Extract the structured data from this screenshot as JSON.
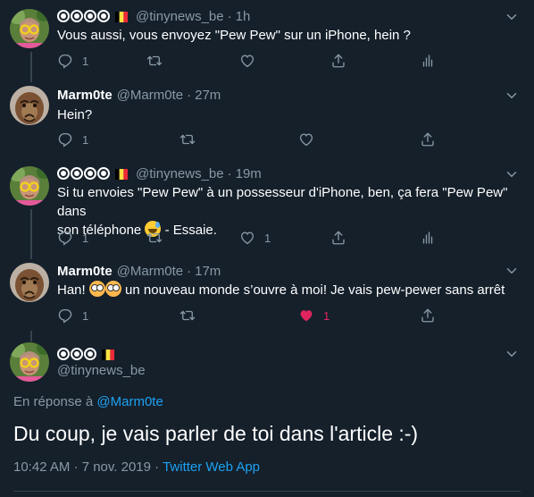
{
  "tweets": [
    {
      "name_circles": 3,
      "handle": "@tinynews_be",
      "time": "1h",
      "text": "Vous aussi, vous envoyez \"Pew Pew\" sur un iPhone, hein ?",
      "reply_count": "1",
      "like_count": ""
    },
    {
      "name": "Marm0te",
      "handle": "@Marm0te",
      "time": "27m",
      "text": "Hein?",
      "reply_count": "1"
    },
    {
      "handle": "@tinynews_be",
      "time": "19m",
      "text_part1": "Si tu envoies \"Pew Pew\" à un possesseur d'iPhone, ben, ça fera \"Pew Pew\" dans",
      "text_part2a": "son téléphone",
      "text_part2b": " - Essaie.",
      "reply_count": "1",
      "like_count": "1"
    },
    {
      "name": "Marm0te",
      "handle": "@Marm0te",
      "time": "17m",
      "text_prefix": "Han!",
      "text_suffix": " un nouveau monde s’ouvre à moi! Je vais pew-pewer sans arrêt",
      "reply_count": "1",
      "like_count": "1"
    }
  ],
  "focus": {
    "handle": "@tinynews_be",
    "reply_prefix": "En réponse à",
    "reply_to": "@Marm0te",
    "text": "Du coup, je vais parler de toi dans l'article :-)",
    "timestamp": "10:42 AM · 7 nov. 2019",
    "separator": " · ",
    "app": "Twitter Web App"
  },
  "separator_dot": "·",
  "colors": {
    "background": "#15202b",
    "secondary_text": "#8899a6",
    "link": "#1da1f2",
    "like": "#e0245e",
    "border": "#38444d"
  },
  "icons": [
    "reply-icon",
    "retweet-icon",
    "like-icon",
    "share-icon",
    "analytics-icon",
    "chevron-down-icon",
    "flag-belgium-icon"
  ]
}
